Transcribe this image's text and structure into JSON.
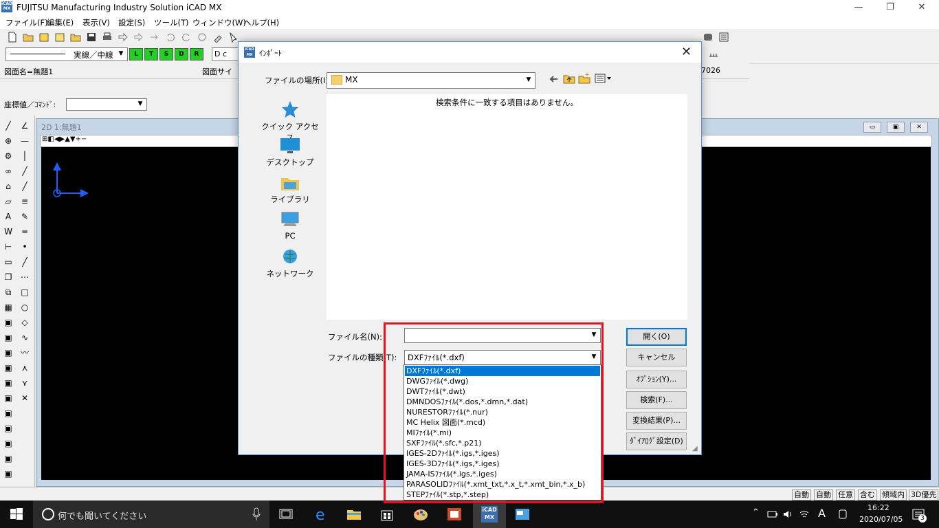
{
  "app": {
    "title": "FUJITSU Manufacturing Industry Solution iCAD MX",
    "logo_text": "iCAD MX",
    "window_buttons": [
      "—",
      "❐",
      "✕"
    ]
  },
  "menu": [
    "ファイル(F)",
    "編集(E)",
    "表示(V)",
    "設定(S)",
    "ツール(T)",
    "ウィンドウ(W)",
    "ヘルプ(H)"
  ],
  "toolbar2": {
    "line_style": "実線／中線",
    "green_buttons": [
      "L",
      "T",
      "S",
      "D",
      "R"
    ],
    "layer_box": "D c"
  },
  "status_info": {
    "drawing_name": "図面名=無題1",
    "drawing_size": "図面サイ",
    "code": "7026"
  },
  "coord": {
    "label": "座標値／ｺﾏﾝﾄﾞ:",
    "value": ""
  },
  "mdi": {
    "title": "2D 1:無題1",
    "buttons": [
      "▭",
      "▣",
      "✕"
    ]
  },
  "bottom_status": {
    "message": "",
    "cells": [
      "自動",
      "自動",
      "任意",
      "含む",
      "傾域内",
      "3D優先"
    ]
  },
  "taskbar": {
    "search_placeholder": "何でも聞いてください",
    "time": "16:22",
    "date": "2020/07/05",
    "ime": "A",
    "notifications": "3"
  },
  "dialog": {
    "title": "ｲﾝﾎﾟｰﾄ",
    "logo_text": "iCAD MX",
    "look_in_label": "ファイルの場所(I):",
    "look_in_value": "MX",
    "places": [
      "クイック アクセス",
      "デスクトップ",
      "ライブラリ",
      "PC",
      "ネットワーク"
    ],
    "empty_message": "検索条件に一致する項目はありません。",
    "filename_label": "ファイル名(N):",
    "filename_value": "",
    "filetype_label": "ファイルの種類(T):",
    "filetype_value": "DXFﾌｧｲﾙ(*.dxf)",
    "buttons": {
      "open": "開く(O)",
      "cancel": "キャンセル",
      "options": "ｵﾌﾟｼｮﾝ(Y)...",
      "search": "検索(F)...",
      "conversion_result": "変換結果(P)...",
      "dialog_settings": "ﾀﾞｲｱﾛｸﾞ設定(D)"
    },
    "filetype_options": [
      "DXFﾌｧｲﾙ(*.dxf)",
      "DWGﾌｧｲﾙ(*.dwg)",
      "DWTﾌｧｲﾙ(*.dwt)",
      "DMNDOSﾌｧｲﾙ(*.dos,*.dmn,*.dat)",
      "NURESTORﾌｧｲﾙ(*.nur)",
      "MC Helix 図面(*.mcd)",
      "MIﾌｧｲﾙ(*.mi)",
      "SXFﾌｧｲﾙ(*.sfc,*.p21)",
      "IGES-2Dﾌｧｲﾙ(*.igs,*.iges)",
      "IGES-3Dﾌｧｲﾙ(*.igs,*.iges)",
      "JAMA-ISﾌｧｲﾙ(*.igs,*.iges)",
      "PARASOLIDﾌｧｲﾙ(*.xmt_txt,*.x_t,*.xmt_bin,*.x_b)",
      "STEPﾌｧｲﾙ(*.stp,*.step)"
    ],
    "selected_option_index": 0
  },
  "colors": {
    "highlight": "#e3141f",
    "selection": "#0078d7",
    "canvas": "#000000",
    "axis": "#1f5fff"
  }
}
